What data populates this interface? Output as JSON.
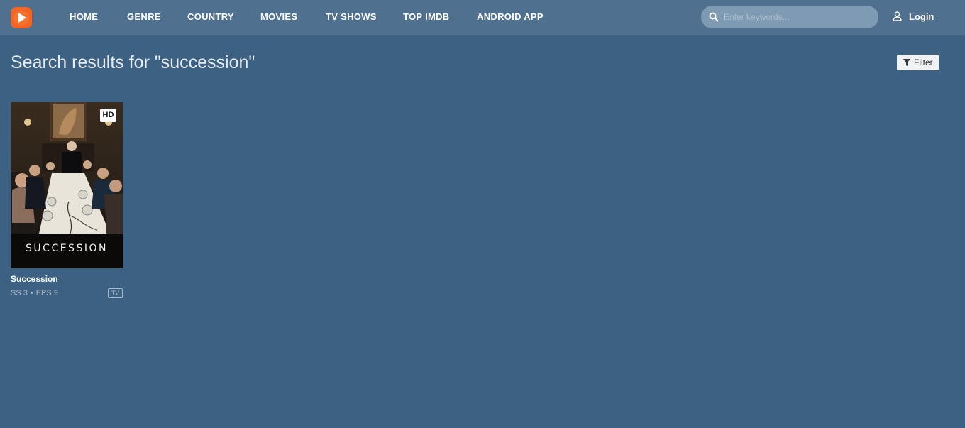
{
  "nav": {
    "items": [
      {
        "label": "HOME"
      },
      {
        "label": "GENRE"
      },
      {
        "label": "COUNTRY"
      },
      {
        "label": "MOVIES"
      },
      {
        "label": "TV SHOWS"
      },
      {
        "label": "TOP IMDB"
      },
      {
        "label": "ANDROID APP"
      }
    ]
  },
  "search": {
    "placeholder": "Enter keywords...",
    "value": ""
  },
  "account": {
    "login_label": "Login"
  },
  "main": {
    "title": "Search results for \"succession\"",
    "filter_label": "Filter"
  },
  "results": [
    {
      "title": "Succession",
      "poster_text": "SUCCESSION",
      "quality": "HD",
      "season": "SS 3",
      "episodes": "EPS 9",
      "type": "TV"
    }
  ],
  "colors": {
    "background": "#3d6182",
    "header": "#50708f",
    "accent": "#f26522"
  },
  "icons": {
    "logo": "play-logo-icon",
    "search": "search-icon",
    "login": "user-icon",
    "filter": "funnel-icon"
  }
}
